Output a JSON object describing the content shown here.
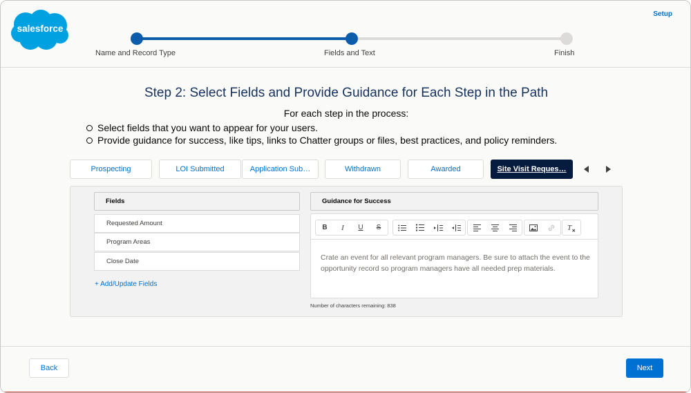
{
  "brand": {
    "logo_text": "salesforce",
    "color": "#00a1e0"
  },
  "header": {
    "setup_label": "Setup"
  },
  "progress": {
    "steps": [
      {
        "label": "Name and Record Type",
        "state": "complete"
      },
      {
        "label": "Fields and Text",
        "state": "current"
      },
      {
        "label": "Finish",
        "state": "incomplete"
      }
    ]
  },
  "main": {
    "title": "Step 2: Select Fields and Provide Guidance for Each Step in the Path",
    "intro": "For each step in the process:",
    "bullets": [
      "Select fields that you want to appear for your users.",
      "Provide guidance for success, like tips, links to Chatter groups or files, best practices, and policy reminders."
    ]
  },
  "path_tabs": {
    "tabs": [
      {
        "label": "Prospecting",
        "active": false
      },
      {
        "label": "LOI Submitted",
        "active": false
      },
      {
        "label": "Application Sub…",
        "active": false
      },
      {
        "label": "Withdrawn",
        "active": false
      },
      {
        "label": "Awarded",
        "active": false
      },
      {
        "label": "Site Visit Reques…",
        "active": true
      }
    ],
    "prev_icon": "triangle-left-icon",
    "next_icon": "triangle-right-icon"
  },
  "fields": {
    "heading": "Fields",
    "rows": [
      "Requested Amount",
      "Program Areas",
      "Close Date"
    ],
    "add_link": "+ Add/Update Fields"
  },
  "guidance": {
    "heading": "Guidance for Success",
    "toolbar_icons": [
      "bold-icon",
      "italic-icon",
      "underline-icon",
      "strikethrough-icon",
      "bulleted-list-icon",
      "numbered-list-icon",
      "indent-icon",
      "outdent-icon",
      "align-left-icon",
      "align-center-icon",
      "align-right-icon",
      "image-icon",
      "link-icon",
      "clear-formatting-icon"
    ],
    "body": "Crate an event for all relevant program managers. Be sure to attach the event to the opportunity record so program managers have all needed prep materials.",
    "chars_remaining": "Number of characters remaining: 838"
  },
  "footer": {
    "back_label": "Back",
    "next_label": "Next"
  },
  "colors": {
    "accent": "#0070d2",
    "progress": "#0b5cab",
    "active_tab": "#061c3f"
  }
}
